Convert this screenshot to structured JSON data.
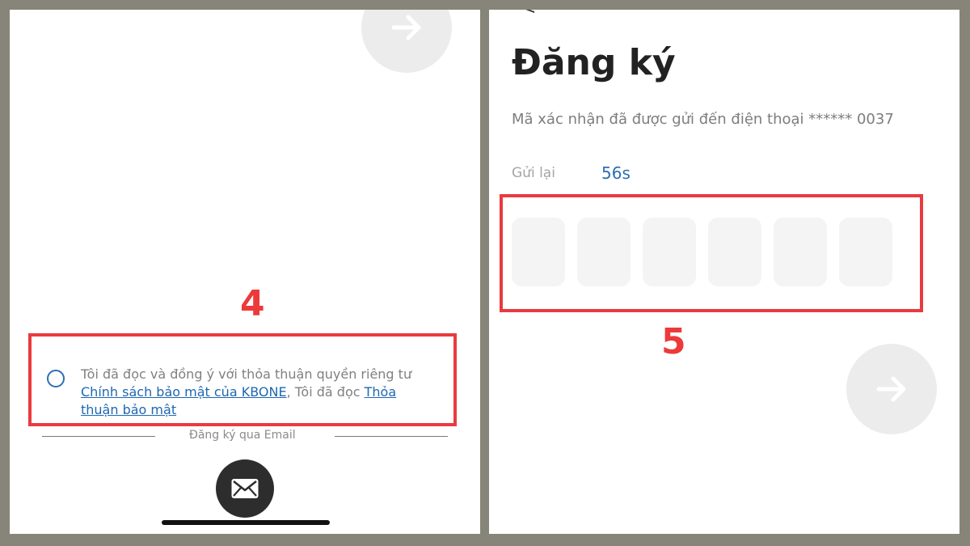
{
  "left": {
    "step_number": "4",
    "consent": {
      "text_part1": "Tôi đã đọc và đồng ý với thỏa thuận quyền riêng tư ",
      "link1": "Chính sách bảo mật của KBONE",
      "text_part2": ", Tôi đã đọc ",
      "link2": "Thỏa thuận bảo mật"
    },
    "divider_label": "Đăng ký qua Email",
    "icons": {
      "next": "arrow-right-icon",
      "mail": "envelope-icon",
      "radio": "radio-unchecked-icon"
    }
  },
  "right": {
    "title": "Đăng ký",
    "subtitle": "Mã xác nhận đã được gửi đến điện thoại ****** 0037",
    "resend_label": "Gửi lại",
    "countdown": "56s",
    "code_boxes": [
      "",
      "",
      "",
      "",
      "",
      ""
    ],
    "step_number": "5",
    "back_glyph": "<",
    "icons": {
      "next": "arrow-right-icon",
      "back": "chevron-left-icon"
    }
  },
  "colors": {
    "highlight": "#e93a3f",
    "link": "#1f67b0",
    "background": "#878579"
  }
}
